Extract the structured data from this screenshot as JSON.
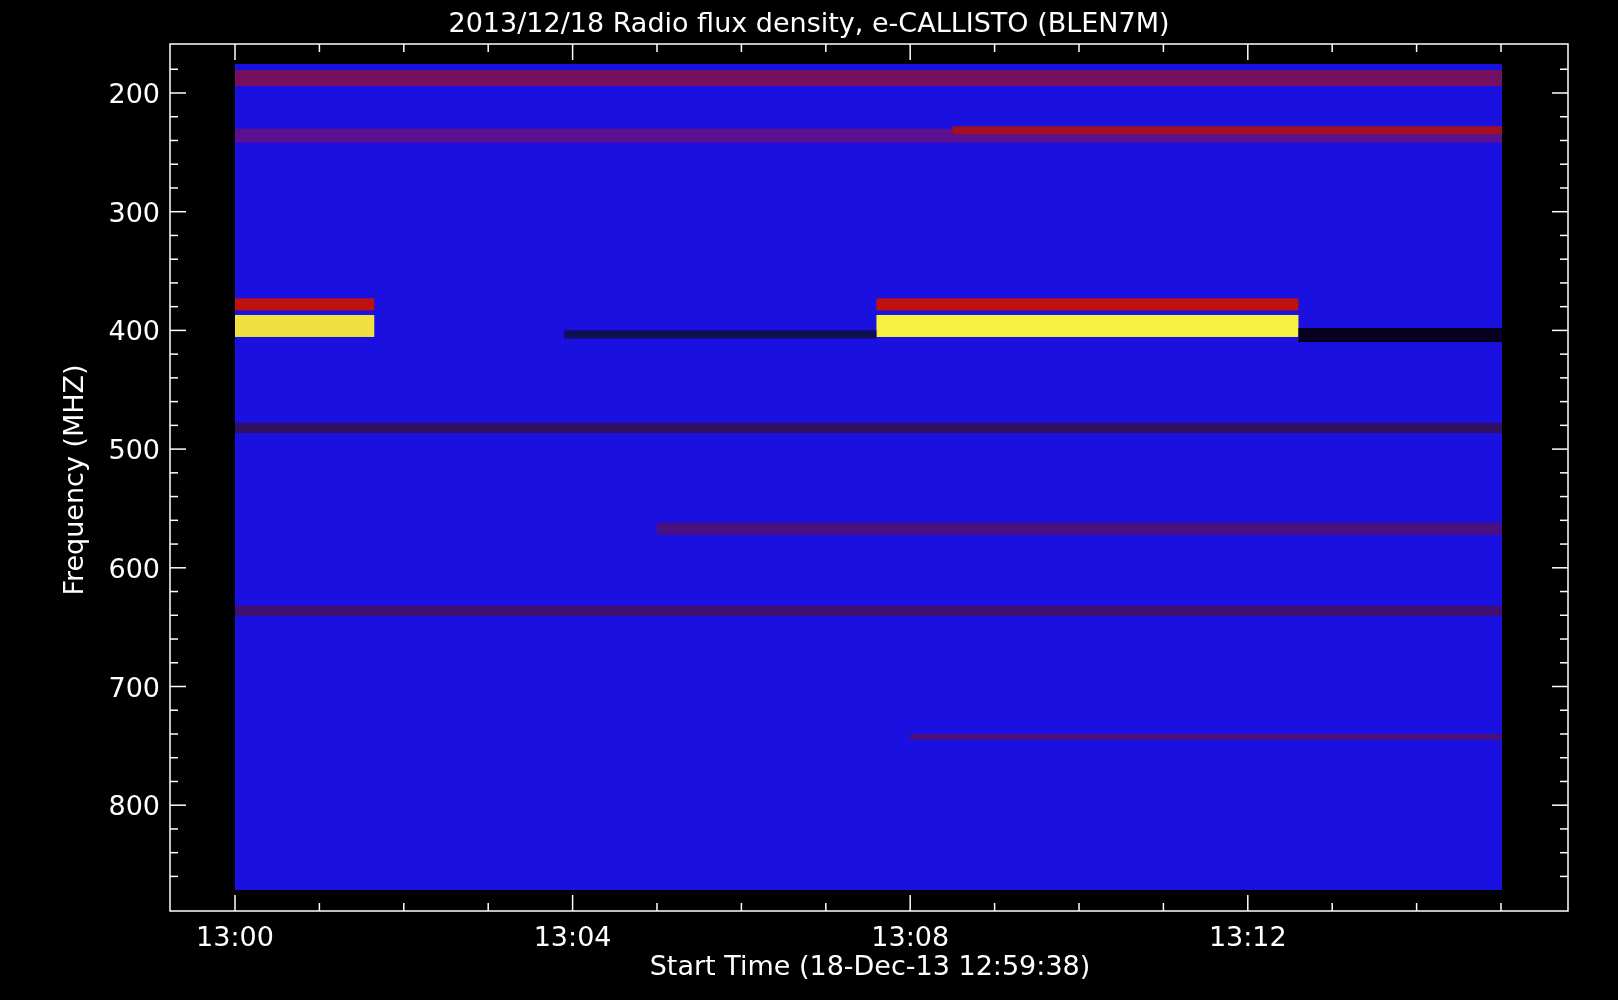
{
  "title": "2013/12/18  Radio flux density, e-CALLISTO (BLEN7M)",
  "y_axis": {
    "label": "Frequency (MHZ)",
    "ticks": [
      "200",
      "300",
      "400",
      "500",
      "600",
      "700",
      "800"
    ]
  },
  "x_axis": {
    "label": "Start Time (18-Dec-13 12:59:38)",
    "ticks": [
      "13:00",
      "13:04",
      "13:08",
      "13:12"
    ]
  }
}
